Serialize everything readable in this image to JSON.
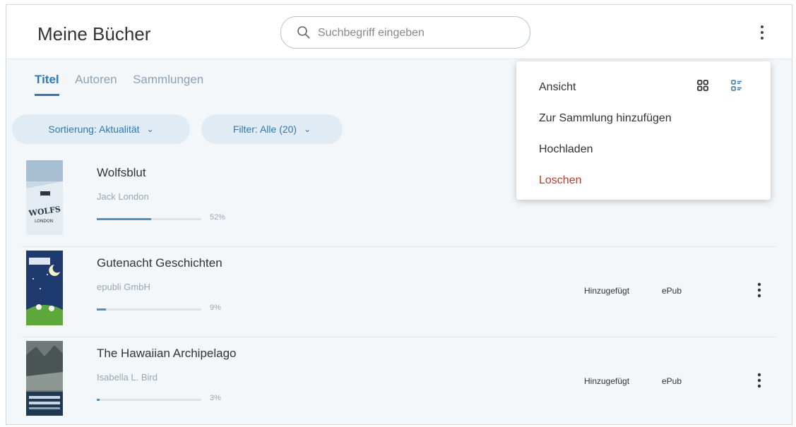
{
  "header": {
    "title": "Meine Bücher",
    "search_placeholder": "Suchbegriff eingeben"
  },
  "tabs": [
    {
      "label": "Titel",
      "active": true
    },
    {
      "label": "Autoren",
      "active": false
    },
    {
      "label": "Sammlungen",
      "active": false
    }
  ],
  "chips": {
    "sort_label": "Sortierung: Aktualität",
    "filter_label": "Filter: Alle (20)"
  },
  "books": [
    {
      "title": "Wolfsblut",
      "author": "Jack London",
      "progress": 0.52,
      "progress_label": "52%",
      "status": "",
      "format": ""
    },
    {
      "title": "Gutenacht Geschichten",
      "author": "epubli GmbH",
      "progress": 0.09,
      "progress_label": "9%",
      "status": "Hinzugefügt",
      "format": "ePub"
    },
    {
      "title": "The Hawaiian Archipelago",
      "author": "Isabella L. Bird",
      "progress": 0.03,
      "progress_label": "3%",
      "status": "Hinzugefügt",
      "format": "ePub"
    }
  ],
  "menu": {
    "ansicht_label": "Ansicht",
    "add_collection_label": "Zur Sammlung hinzufügen",
    "upload_label": "Hochladen",
    "delete_label": "Loschen"
  },
  "icons": {
    "search": "search-icon",
    "more": "more-vertical-icon",
    "grid_view": "grid-view-icon",
    "list_view": "list-view-icon",
    "chevron": "chevron-down-icon"
  },
  "colors": {
    "accent": "#2e78b7",
    "danger": "#d0312d",
    "chip_bg": "#e1ebf3",
    "page_bg": "#f3f7fa"
  }
}
